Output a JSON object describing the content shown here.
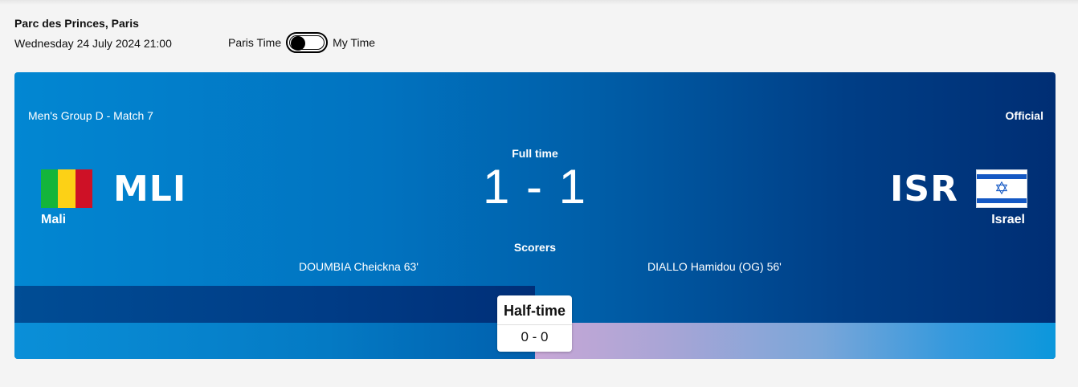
{
  "header": {
    "venue": "Parc des Princes, Paris",
    "datetime": "Wednesday 24 July 2024 21:00",
    "toggle_left_label": "Paris Time",
    "toggle_right_label": "My Time",
    "toggle_state": "Paris Time"
  },
  "match": {
    "label": "Men's Group D - Match 7",
    "official_label": "Official",
    "status": "Full time",
    "score": "1 - 1",
    "home": {
      "code": "MLI",
      "name": "Mali",
      "flag_icon": "mali-flag-icon",
      "flag_colors": [
        "#14b53a",
        "#fcd116",
        "#ce1126"
      ],
      "scorer": "DOUMBIA Cheickna 63'"
    },
    "away": {
      "code": "ISR",
      "name": "Israel",
      "flag_icon": "israel-flag-icon",
      "flag_colors": [
        "#ffffff",
        "#1458c4"
      ],
      "flag_symbol": "✡",
      "scorer": "DIALLO Hamidou (OG) 56'"
    },
    "scorers_title": "Scorers",
    "halftime": {
      "label": "Half-time",
      "score": "0 - 0"
    }
  }
}
